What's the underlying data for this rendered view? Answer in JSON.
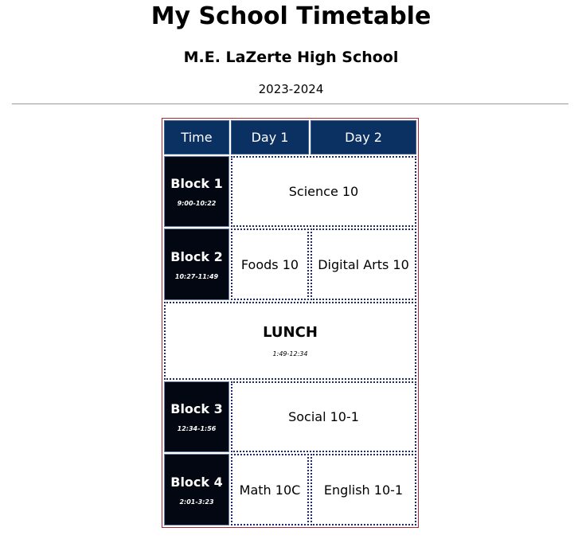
{
  "page": {
    "title": "My School Timetable",
    "school": "M.E. LaZerte High School",
    "year": "2023-2024"
  },
  "timetable": {
    "headers": [
      "Time",
      "Day 1",
      "Day 2"
    ],
    "blocks": [
      {
        "name": "Block 1",
        "time": "9:00-10:22",
        "day1": "Science 10",
        "day2": "Science 10",
        "merged": true
      },
      {
        "name": "Block 2",
        "time": "10:27-11:49",
        "day1": "Foods 10",
        "day2": "Digital Arts 10",
        "merged": false
      },
      {
        "name": "Block 3",
        "time": "12:34-1:56",
        "day1": "Social 10-1",
        "day2": "Social 10-1",
        "merged": true
      },
      {
        "name": "Block 4",
        "time": "2:01-3:23",
        "day1": "Math 10C",
        "day2": "English 10-1",
        "merged": false
      }
    ],
    "lunch": {
      "name": "LUNCH",
      "time": "1:49-12:34"
    }
  },
  "colors": {
    "header_bg": "#0b3163",
    "block_bg": "#030712",
    "table_border": "#b0253a",
    "cell_border": "#1f2a6b"
  }
}
